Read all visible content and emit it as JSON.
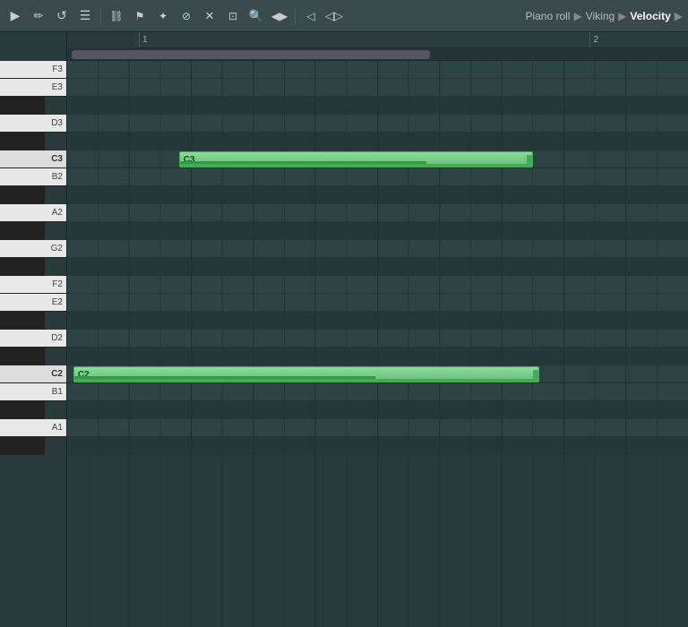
{
  "toolbar": {
    "title": "Piano roll",
    "breadcrumb": [
      "Piano roll",
      "Viking",
      "Velocity"
    ],
    "icons": [
      {
        "name": "pointer-icon",
        "symbol": "▶"
      },
      {
        "name": "pencil-icon",
        "symbol": "✏"
      },
      {
        "name": "loop-icon",
        "symbol": "↻"
      },
      {
        "name": "settings-icon",
        "symbol": "☰"
      },
      {
        "name": "magnet-icon",
        "symbol": "⌘"
      },
      {
        "name": "select-icon",
        "symbol": "⊹"
      },
      {
        "name": "transform-icon",
        "symbol": "⚙"
      },
      {
        "name": "cut-icon",
        "symbol": "⊘"
      },
      {
        "name": "mute-icon",
        "symbol": "✕"
      },
      {
        "name": "select2-icon",
        "symbol": "⊡"
      },
      {
        "name": "zoom-icon",
        "symbol": "⊕"
      },
      {
        "name": "play-icon",
        "symbol": "◀▶"
      },
      {
        "name": "speaker-icon",
        "symbol": "◁"
      },
      {
        "name": "speaker2-icon",
        "symbol": "◁▷"
      }
    ]
  },
  "ruler": {
    "markers": [
      {
        "label": "1",
        "pos_pct": 0
      },
      {
        "label": "2",
        "pos_pct": 90
      }
    ]
  },
  "piano_keys": [
    {
      "note": "F3",
      "type": "white"
    },
    {
      "note": "E3",
      "type": "white"
    },
    {
      "note": "Eb3",
      "type": "black",
      "label": ""
    },
    {
      "note": "D3",
      "type": "white"
    },
    {
      "note": "Db3",
      "type": "black",
      "label": ""
    },
    {
      "note": "C3",
      "type": "c",
      "label": "C3"
    },
    {
      "note": "B2",
      "type": "white"
    },
    {
      "note": "Bb2",
      "type": "black",
      "label": ""
    },
    {
      "note": "A2",
      "type": "white"
    },
    {
      "note": "Ab2",
      "type": "black",
      "label": ""
    },
    {
      "note": "G2",
      "type": "white"
    },
    {
      "note": "Gb2",
      "type": "black",
      "label": ""
    },
    {
      "note": "F2",
      "type": "white"
    },
    {
      "note": "E2",
      "type": "white"
    },
    {
      "note": "Eb2",
      "type": "black",
      "label": ""
    },
    {
      "note": "D2",
      "type": "white"
    },
    {
      "note": "Db2",
      "type": "black",
      "label": ""
    },
    {
      "note": "C2",
      "type": "c",
      "label": "C2"
    },
    {
      "note": "B1",
      "type": "white"
    },
    {
      "note": "Bb1",
      "type": "black",
      "label": ""
    },
    {
      "note": "A1",
      "type": "white"
    },
    {
      "note": "Ab1",
      "type": "black",
      "label": ""
    }
  ],
  "grid_rows": [
    {
      "type": "white",
      "note": "F3"
    },
    {
      "type": "white",
      "note": "E3"
    },
    {
      "type": "black",
      "note": "Eb3"
    },
    {
      "type": "white",
      "note": "D3"
    },
    {
      "type": "black",
      "note": "Db3"
    },
    {
      "type": "c",
      "note": "C3"
    },
    {
      "type": "white",
      "note": "B2"
    },
    {
      "type": "black",
      "note": "Bb2"
    },
    {
      "type": "white",
      "note": "A2"
    },
    {
      "type": "black",
      "note": "Ab2"
    },
    {
      "type": "white",
      "note": "G2"
    },
    {
      "type": "black",
      "note": "Gb2"
    },
    {
      "type": "white",
      "note": "F2"
    },
    {
      "type": "white",
      "note": "E2"
    },
    {
      "type": "black",
      "note": "Eb2"
    },
    {
      "type": "white",
      "note": "D2"
    },
    {
      "type": "black",
      "note": "Db2"
    },
    {
      "type": "c",
      "note": "C2"
    },
    {
      "type": "white",
      "note": "B1"
    },
    {
      "type": "black",
      "note": "Bb1"
    },
    {
      "type": "white",
      "note": "A1"
    },
    {
      "type": "black",
      "note": "Ab1"
    }
  ],
  "notes": [
    {
      "id": "note-c3",
      "label": "C3",
      "row": 5,
      "left_pct": 18,
      "width_pct": 57,
      "velocity_pct": 70
    },
    {
      "id": "note-c2",
      "label": "C2",
      "row": 17,
      "left_pct": 1,
      "width_pct": 75,
      "velocity_pct": 65
    }
  ],
  "colors": {
    "note_fill_top": "#88dd99",
    "note_fill_bottom": "#66bb77",
    "note_border": "#44aa55",
    "background": "#2a3a3a",
    "toolbar_bg": "#3a4a4a"
  }
}
